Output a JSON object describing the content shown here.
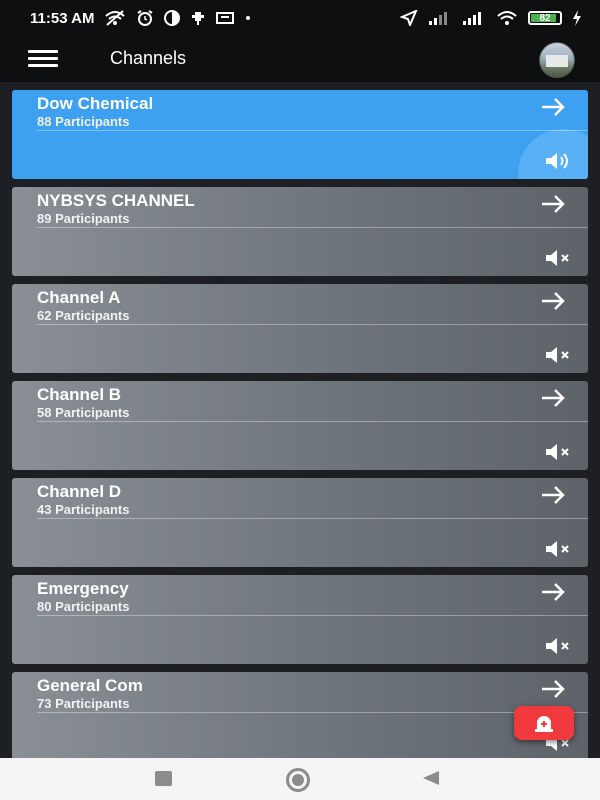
{
  "status_bar": {
    "time": "11:53 AM",
    "battery": "82",
    "icons": [
      "wifi-off-icon",
      "alarm-icon",
      "contrast-icon",
      "usb-icon",
      "screen-icon",
      "dot-icon",
      "location-icon",
      "signal-icon",
      "signal-icon",
      "wifi-icon",
      "battery-icon",
      "charging-icon"
    ]
  },
  "app_bar": {
    "title": "Channels",
    "menu_icon": "menu-icon",
    "avatar_icon": "avatar"
  },
  "channels": [
    {
      "name": "Dow Chemical",
      "participants": "88 Participants",
      "active": true,
      "audio": "speaker-on-icon"
    },
    {
      "name": "NYBSYS CHANNEL",
      "participants": "89 Participants",
      "active": false,
      "audio": "speaker-muted-icon"
    },
    {
      "name": "Channel A",
      "participants": "62 Participants",
      "active": false,
      "audio": "speaker-muted-icon"
    },
    {
      "name": "Channel B",
      "participants": "58 Participants",
      "active": false,
      "audio": "speaker-muted-icon"
    },
    {
      "name": "Channel D",
      "participants": "43 Participants",
      "active": false,
      "audio": "speaker-muted-icon"
    },
    {
      "name": "Emergency",
      "participants": "80 Participants",
      "active": false,
      "audio": "speaker-muted-icon"
    },
    {
      "name": "General Com",
      "participants": "73 Participants",
      "active": false,
      "audio": "speaker-muted-icon"
    }
  ],
  "fab": {
    "icon": "emergency-alert-icon"
  },
  "colors": {
    "active_card": "#3da0f0",
    "inactive_card": "#6f757c",
    "fab": "#f03a3e",
    "background": "#1d1f22"
  }
}
